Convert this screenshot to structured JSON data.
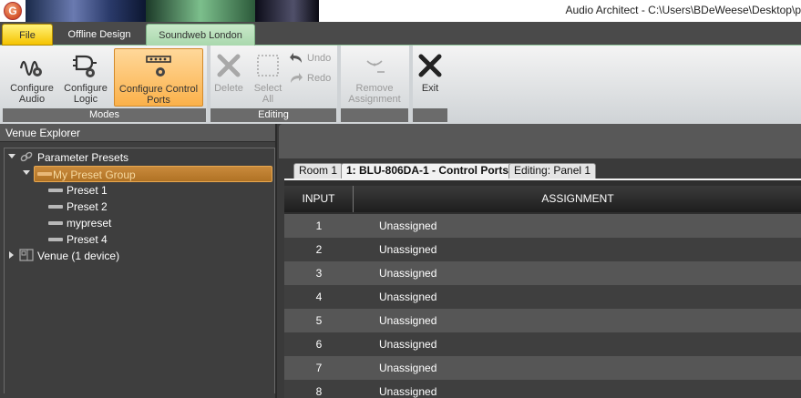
{
  "window": {
    "title": "Audio Architect - C:\\Users\\BDeWeese\\Desktop\\p"
  },
  "tabs": [
    {
      "label": "File"
    },
    {
      "label": "Offline Design"
    },
    {
      "label": "Soundweb London"
    }
  ],
  "ribbon": {
    "modes": {
      "label": "Modes",
      "configure_audio": "Configure Audio",
      "configure_logic": "Configure Logic",
      "configure_control_ports": "Configure Control Ports"
    },
    "editing": {
      "label": "Editing",
      "delete": "Delete",
      "select_all": "Select All",
      "undo": "Undo",
      "redo": "Redo"
    },
    "remove_assignment": "Remove Assignment",
    "exit": "Exit"
  },
  "explorer": {
    "title": "Venue Explorer",
    "parameter_presets": "Parameter Presets",
    "preset_group": "My Preset Group",
    "presets": [
      "Preset 1",
      "Preset 2",
      "mypreset",
      "Preset 4"
    ],
    "venue": "Venue (1 device)"
  },
  "doc_tabs": [
    "Room 1",
    "1: BLU-806DA-1 - Control Ports",
    "Editing: Panel 1"
  ],
  "grid": {
    "headers": {
      "input": "INPUT",
      "assignment": "ASSIGNMENT"
    },
    "rows": [
      {
        "input": "1",
        "assignment": "Unassigned"
      },
      {
        "input": "2",
        "assignment": "Unassigned"
      },
      {
        "input": "3",
        "assignment": "Unassigned"
      },
      {
        "input": "4",
        "assignment": "Unassigned"
      },
      {
        "input": "5",
        "assignment": "Unassigned"
      },
      {
        "input": "6",
        "assignment": "Unassigned"
      },
      {
        "input": "7",
        "assignment": "Unassigned"
      },
      {
        "input": "8",
        "assignment": "Unassigned"
      }
    ]
  }
}
